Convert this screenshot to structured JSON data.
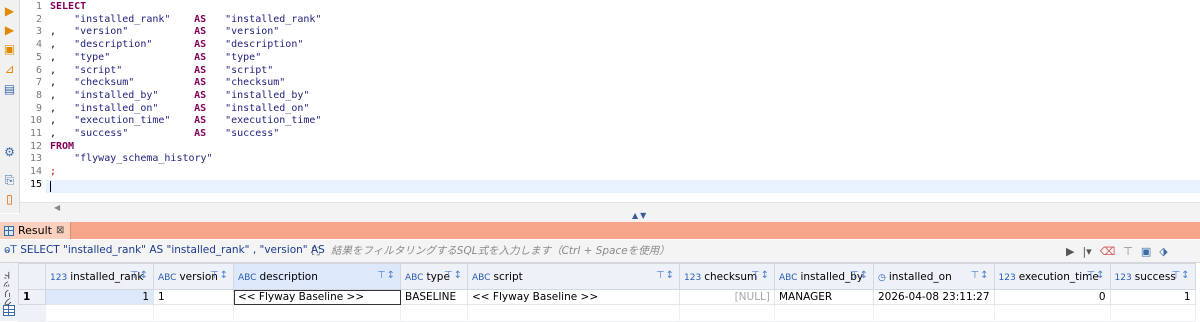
{
  "toolbar": {
    "icons": [
      "execute-statement-icon",
      "execute-script-icon",
      "execute-new-tab-icon",
      "explain-plan-icon",
      "load-script-icon",
      "settings-icon",
      "export-icon",
      "import-icon"
    ]
  },
  "editor": {
    "line_numbers": [
      "1",
      "2",
      "3",
      "4",
      "5",
      "6",
      "7",
      "8",
      "9",
      "10",
      "11",
      "12",
      "13",
      "14",
      "15"
    ],
    "lines": [
      {
        "lead": "SELECT",
        "col": "",
        "kw": "",
        "alias": ""
      },
      {
        "lead": "    ",
        "col": "\"installed_rank\"",
        "kw": "AS",
        "alias": "\"installed_rank\""
      },
      {
        "lead": ",   ",
        "col": "\"version\"",
        "kw": "AS",
        "alias": "\"version\""
      },
      {
        "lead": ",   ",
        "col": "\"description\"",
        "kw": "AS",
        "alias": "\"description\""
      },
      {
        "lead": ",   ",
        "col": "\"type\"",
        "kw": "AS",
        "alias": "\"type\""
      },
      {
        "lead": ",   ",
        "col": "\"script\"",
        "kw": "AS",
        "alias": "\"script\""
      },
      {
        "lead": ",   ",
        "col": "\"checksum\"",
        "kw": "AS",
        "alias": "\"checksum\""
      },
      {
        "lead": ",   ",
        "col": "\"installed_by\"",
        "kw": "AS",
        "alias": "\"installed_by\""
      },
      {
        "lead": ",   ",
        "col": "\"installed_on\"",
        "kw": "AS",
        "alias": "\"installed_on\""
      },
      {
        "lead": ",   ",
        "col": "\"execution_time\"",
        "kw": "AS",
        "alias": "\"execution_time\""
      },
      {
        "lead": ",   ",
        "col": "\"success\"",
        "kw": "AS",
        "alias": "\"success\""
      },
      {
        "lead": "FROM",
        "col": "",
        "kw": "",
        "alias": ""
      },
      {
        "lead": "    ",
        "col": "\"flyway_schema_history\"",
        "kw": "",
        "alias": ""
      },
      {
        "lead": ";",
        "col": "",
        "kw": "",
        "alias": ""
      },
      {
        "lead": "",
        "col": "",
        "kw": "",
        "alias": ""
      }
    ]
  },
  "result": {
    "tab_label": "Result",
    "query_text": "SELECT \"installed_rank\" AS \"installed_rank\" , \"version\" AS \"version\"",
    "filter_placeholder": "結果をフィルタリングするSQL式を入力します（Ctrl + Spaceを使用）",
    "side_label": "グリッド",
    "columns": [
      {
        "badge": "123",
        "name": "installed_rank"
      },
      {
        "badge": "ABC",
        "name": "version"
      },
      {
        "badge": "ABC",
        "name": "description"
      },
      {
        "badge": "ABC",
        "name": "type"
      },
      {
        "badge": "ABC",
        "name": "script"
      },
      {
        "badge": "123",
        "name": "checksum"
      },
      {
        "badge": "ABC",
        "name": "installed_by"
      },
      {
        "badge": "◷",
        "name": "installed_on"
      },
      {
        "badge": "123",
        "name": "execution_time"
      },
      {
        "badge": "123",
        "name": "success"
      }
    ],
    "rows": [
      {
        "num": "1",
        "cells": [
          "1",
          "1",
          "<< Flyway Baseline >>",
          "BASELINE",
          "<< Flyway Baseline >>",
          "[NULL]",
          "MANAGER",
          "2026-04-08 23:11:27",
          "0",
          "1"
        ]
      }
    ]
  }
}
